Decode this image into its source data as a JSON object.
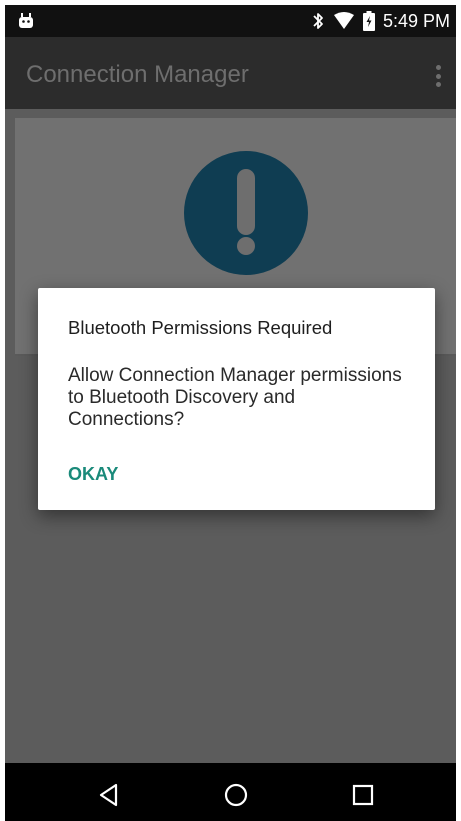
{
  "status_bar": {
    "time": "5:49 PM",
    "left_icon": "android-debug-icon",
    "icons": [
      "bluetooth-icon",
      "wifi-icon",
      "battery-charging-icon"
    ]
  },
  "app_bar": {
    "title": "Connection Manager",
    "menu_icon": "overflow-menu-icon"
  },
  "content": {
    "icon": "alert-exclamation-icon",
    "icon_color": "#0f3d52"
  },
  "dialog": {
    "title": "Bluetooth Permissions Required",
    "message": "Allow Connection Manager permissions to Bluetooth Discovery and Connections?",
    "button_label": "OKAY",
    "button_color": "#1a8a7a"
  },
  "nav_bar": {
    "buttons": [
      "back-icon",
      "home-icon",
      "recents-icon"
    ]
  }
}
